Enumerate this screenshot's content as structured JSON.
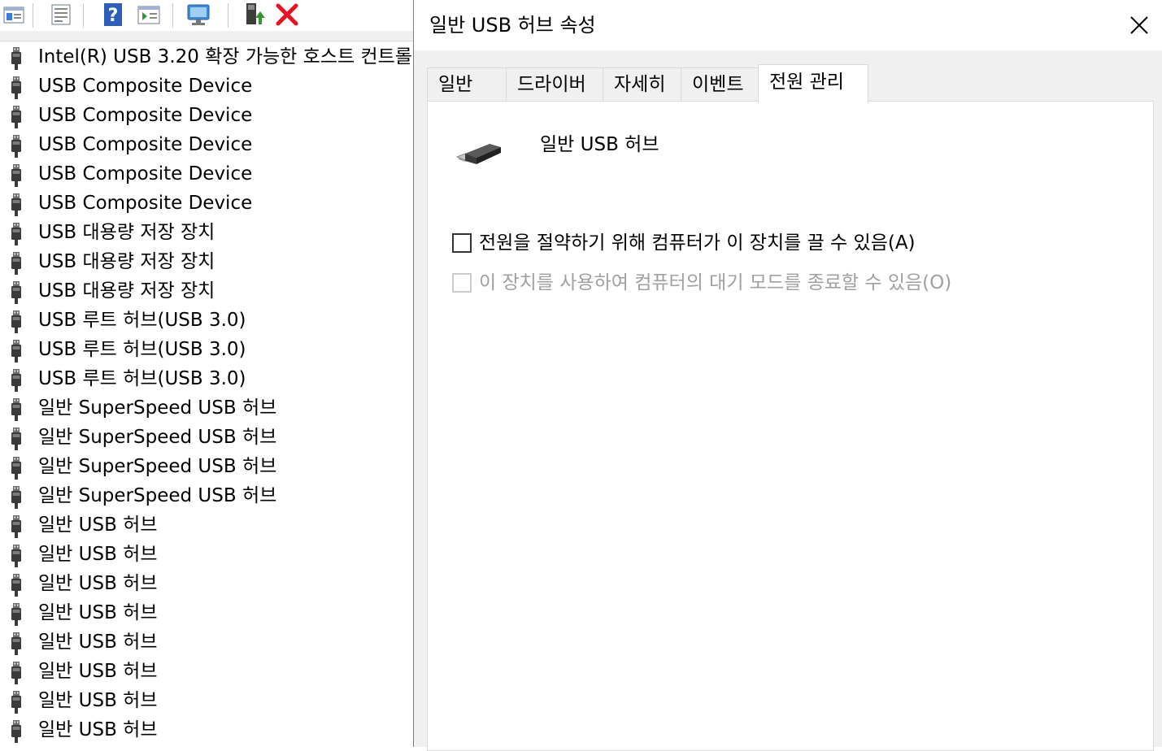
{
  "device_manager": {
    "items": [
      {
        "label": "Intel(R) USB 3.20 확장 가능한 호스트 컨트롤"
      },
      {
        "label": "USB Composite Device"
      },
      {
        "label": "USB Composite Device"
      },
      {
        "label": "USB Composite Device"
      },
      {
        "label": "USB Composite Device"
      },
      {
        "label": "USB Composite Device"
      },
      {
        "label": "USB 대용량 저장 장치"
      },
      {
        "label": "USB 대용량 저장 장치"
      },
      {
        "label": "USB 대용량 저장 장치"
      },
      {
        "label": "USB 루트 허브(USB 3.0)"
      },
      {
        "label": "USB 루트 허브(USB 3.0)"
      },
      {
        "label": "USB 루트 허브(USB 3.0)"
      },
      {
        "label": "일반 SuperSpeed USB 허브"
      },
      {
        "label": "일반 SuperSpeed USB 허브"
      },
      {
        "label": "일반 SuperSpeed USB 허브"
      },
      {
        "label": "일반 SuperSpeed USB 허브"
      },
      {
        "label": "일반 USB 허브"
      },
      {
        "label": "일반 USB 허브"
      },
      {
        "label": "일반 USB 허브"
      },
      {
        "label": "일반 USB 허브"
      },
      {
        "label": "일반 USB 허브"
      },
      {
        "label": "일반 USB 허브"
      },
      {
        "label": "일반 USB 허브"
      },
      {
        "label": "일반 USB 허브"
      }
    ],
    "toolbar_icons": [
      "show-hidden-icon",
      "properties-icon",
      "help-icon",
      "view-resources-icon",
      "scan-hardware-icon",
      "update-driver-icon",
      "uninstall-device-icon"
    ]
  },
  "dialog": {
    "title": "일반 USB 허브 속성",
    "tabs": [
      {
        "label": "일반",
        "active": false
      },
      {
        "label": "드라이버",
        "active": false
      },
      {
        "label": "자세히",
        "active": false
      },
      {
        "label": "이벤트",
        "active": false
      },
      {
        "label": "전원 관리",
        "active": true
      }
    ],
    "device_name": "일반 USB 허브",
    "options": {
      "allow_power_off": {
        "label": "전원을 절약하기 위해 컴퓨터가 이 장치를 끌 수 있음(A)",
        "checked": false,
        "enabled": true
      },
      "allow_wake": {
        "label": "이 장치를 사용하여 컴퓨터의 대기 모드를 종료할 수 있음(O)",
        "checked": false,
        "enabled": false
      }
    }
  },
  "colors": {
    "uninstall": "#e81123",
    "help": "#2b5fb8",
    "update": "#2e9a2e"
  }
}
